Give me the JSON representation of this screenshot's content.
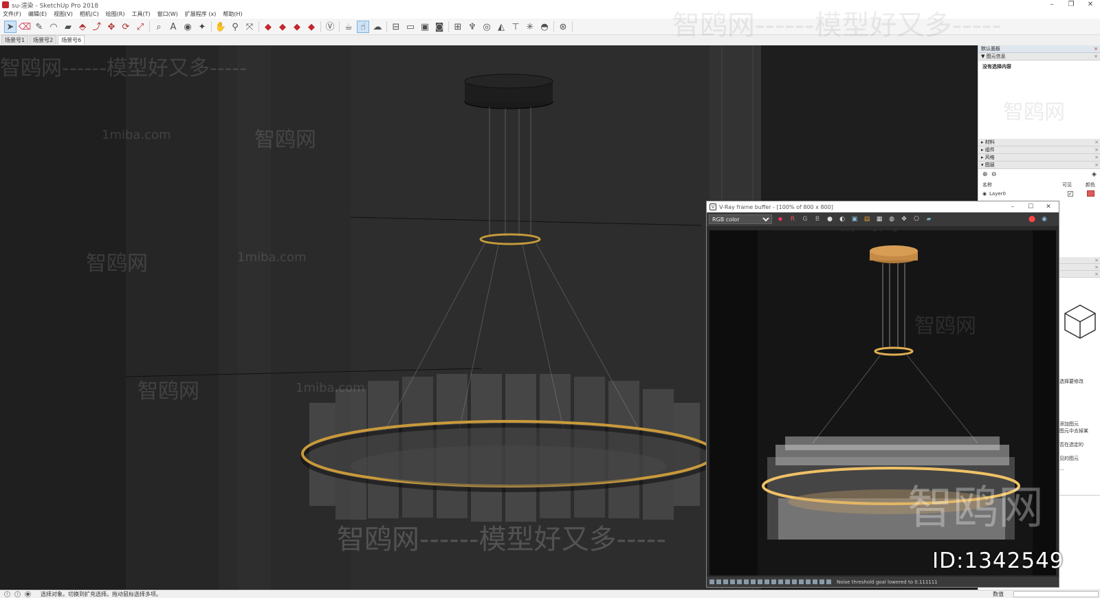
{
  "window": {
    "title": "su-渲染 - SketchUp Pro 2018",
    "controls": [
      "–",
      "❐",
      "✕"
    ]
  },
  "menu": [
    "文件(F)",
    "编辑(E)",
    "视图(V)",
    "相机(C)",
    "绘图(R)",
    "工具(T)",
    "窗口(W)",
    "扩展程序 (x)",
    "帮助(H)"
  ],
  "toolbar": {
    "tools": [
      {
        "name": "select-icon",
        "glyph": "➤",
        "selected": true
      },
      {
        "name": "eraser-icon",
        "glyph": "⌫"
      },
      {
        "name": "pencil-icon",
        "glyph": "✎"
      },
      {
        "name": "arc-icon",
        "glyph": "◠"
      },
      {
        "name": "rectangle-icon",
        "glyph": "▰"
      },
      {
        "name": "push-pull-icon",
        "glyph": "⬘"
      },
      {
        "name": "follow-me-icon",
        "glyph": "⤴"
      },
      {
        "name": "move-icon",
        "glyph": "✥"
      },
      {
        "name": "rotate-icon",
        "glyph": "⟳"
      },
      {
        "name": "scale-icon",
        "glyph": "⤢"
      },
      {
        "name": "tape-measure-icon",
        "glyph": "⌕"
      },
      {
        "name": "text-icon",
        "glyph": "A"
      },
      {
        "name": "paint-bucket-icon",
        "glyph": "◉"
      },
      {
        "name": "orbit-icon",
        "glyph": "✦"
      },
      {
        "name": "pan-icon",
        "glyph": "✋"
      },
      {
        "name": "zoom-icon",
        "glyph": "⚲"
      },
      {
        "name": "zoom-extents-icon",
        "glyph": "⤧"
      },
      {
        "name": "vray-render-icon",
        "glyph": "◆"
      },
      {
        "name": "vray-interactive-icon",
        "glyph": "◆"
      },
      {
        "name": "vray-cloud-icon",
        "glyph": "◆"
      },
      {
        "name": "vray-buffer-icon",
        "glyph": "◆"
      },
      {
        "name": "vray-logo-icon",
        "glyph": "Ⓥ"
      },
      {
        "name": "teapot-icon",
        "glyph": "☕"
      },
      {
        "name": "hand-cursor-icon",
        "glyph": "☝",
        "selected": true
      },
      {
        "name": "cloud-icon",
        "glyph": "☁"
      },
      {
        "name": "section-icon",
        "glyph": "⊟"
      },
      {
        "name": "window-icon",
        "glyph": "▭"
      },
      {
        "name": "window2-icon",
        "glyph": "▣"
      },
      {
        "name": "camera-icon",
        "glyph": "◙"
      },
      {
        "name": "lock-icon",
        "glyph": "⊞"
      },
      {
        "name": "light-icon",
        "glyph": "♆"
      },
      {
        "name": "sphere-light-icon",
        "glyph": "◎"
      },
      {
        "name": "spot-light-icon",
        "glyph": "◭"
      },
      {
        "name": "ies-light-icon",
        "glyph": "⊤"
      },
      {
        "name": "omni-light-icon",
        "glyph": "✳"
      },
      {
        "name": "dome-light-icon",
        "glyph": "◓"
      },
      {
        "name": "mesh-light-icon",
        "glyph": "⊛"
      },
      {
        "name": "cleaner-icon",
        "glyph": "🖌"
      }
    ]
  },
  "scenes": [
    "场景号1",
    "场景号2",
    "场景号6"
  ],
  "active_scene": 2,
  "tray": {
    "title": "默认面板",
    "entity_info_label": "图元信息",
    "entity_info_text": "没有选择内容",
    "sections": [
      "材料",
      "组件",
      "风格",
      "图层"
    ],
    "layers": {
      "name_header": "名称",
      "visible_header": "可见",
      "color_header": "颜色",
      "rows": [
        {
          "name": "Layer0",
          "visible": "✓",
          "color": "#e05a5a"
        }
      ]
    },
    "hint_lines": [
      "选择要修改",
      "添加图元",
      "图元中去掉某",
      "否在选定的",
      "见的图元",
      "…"
    ]
  },
  "vray": {
    "title": "V-Ray frame buffer - [100% of 800 x 800]",
    "channel": "RGB color",
    "channel_options": [
      "RGB color"
    ],
    "status": "Noise threshold goal lowered to 0.111111"
  },
  "status": {
    "message": "选择对象。切换到扩充选择。拖动鼠标选择多项。",
    "vcb_label": "数值"
  },
  "watermark": {
    "site": "1miba.com",
    "brand": "智鸥网",
    "slogan": "智鸥网------模型好又多-----",
    "dashes": "------",
    "id": "ID:1342549"
  }
}
